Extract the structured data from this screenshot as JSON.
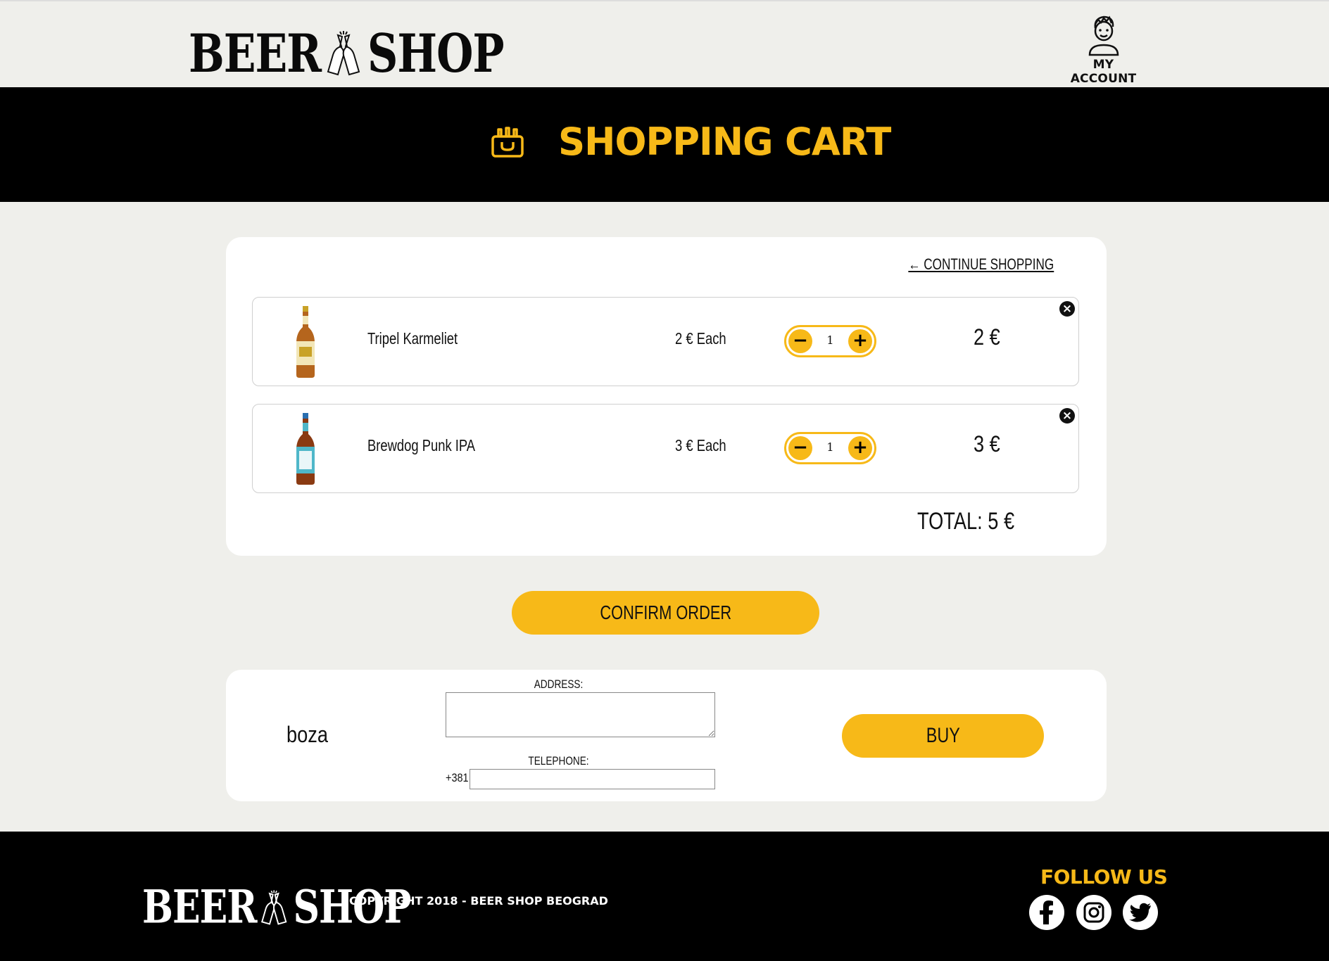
{
  "header": {
    "logo_word1": "BEER",
    "logo_word2": "SHOP",
    "account_label": "MY ACCOUNT"
  },
  "banner": {
    "title": "SHOPPING CART",
    "icon": "beer-crate-icon"
  },
  "cart": {
    "continue_label": "← CONTINUE SHOPPING",
    "items": [
      {
        "name": "Tripel Karmeliet",
        "each": "2 € Each",
        "quantity": "1",
        "total": "2 €",
        "minus": "−",
        "plus": "+",
        "remove": "×"
      },
      {
        "name": "Brewdog Punk IPA",
        "each": "3 € Each",
        "quantity": "1",
        "total": "3 €",
        "minus": "−",
        "plus": "+",
        "remove": "×"
      }
    ],
    "grand_total": "TOTAL: 5 €"
  },
  "confirm_label": "CONFIRM ORDER",
  "checkout": {
    "username": "boza",
    "address_label": "ADDRESS:",
    "address_value": "",
    "telephone_label": "TELEPHONE:",
    "telephone_prefix": "+381",
    "telephone_value": "",
    "buy_label": "BUY"
  },
  "footer": {
    "logo_word1": "BEER",
    "logo_word2": "SHOP",
    "copyright": "COPYRIGHT 2018 - BEER SHOP BEOGRAD",
    "follow_label": "FOLLOW US",
    "social": [
      "facebook-icon",
      "instagram-icon",
      "twitter-icon"
    ]
  },
  "colors": {
    "accent": "#f7b918",
    "dark": "#000000",
    "page_bg": "#efefeb",
    "card_bg": "#ffffff"
  }
}
